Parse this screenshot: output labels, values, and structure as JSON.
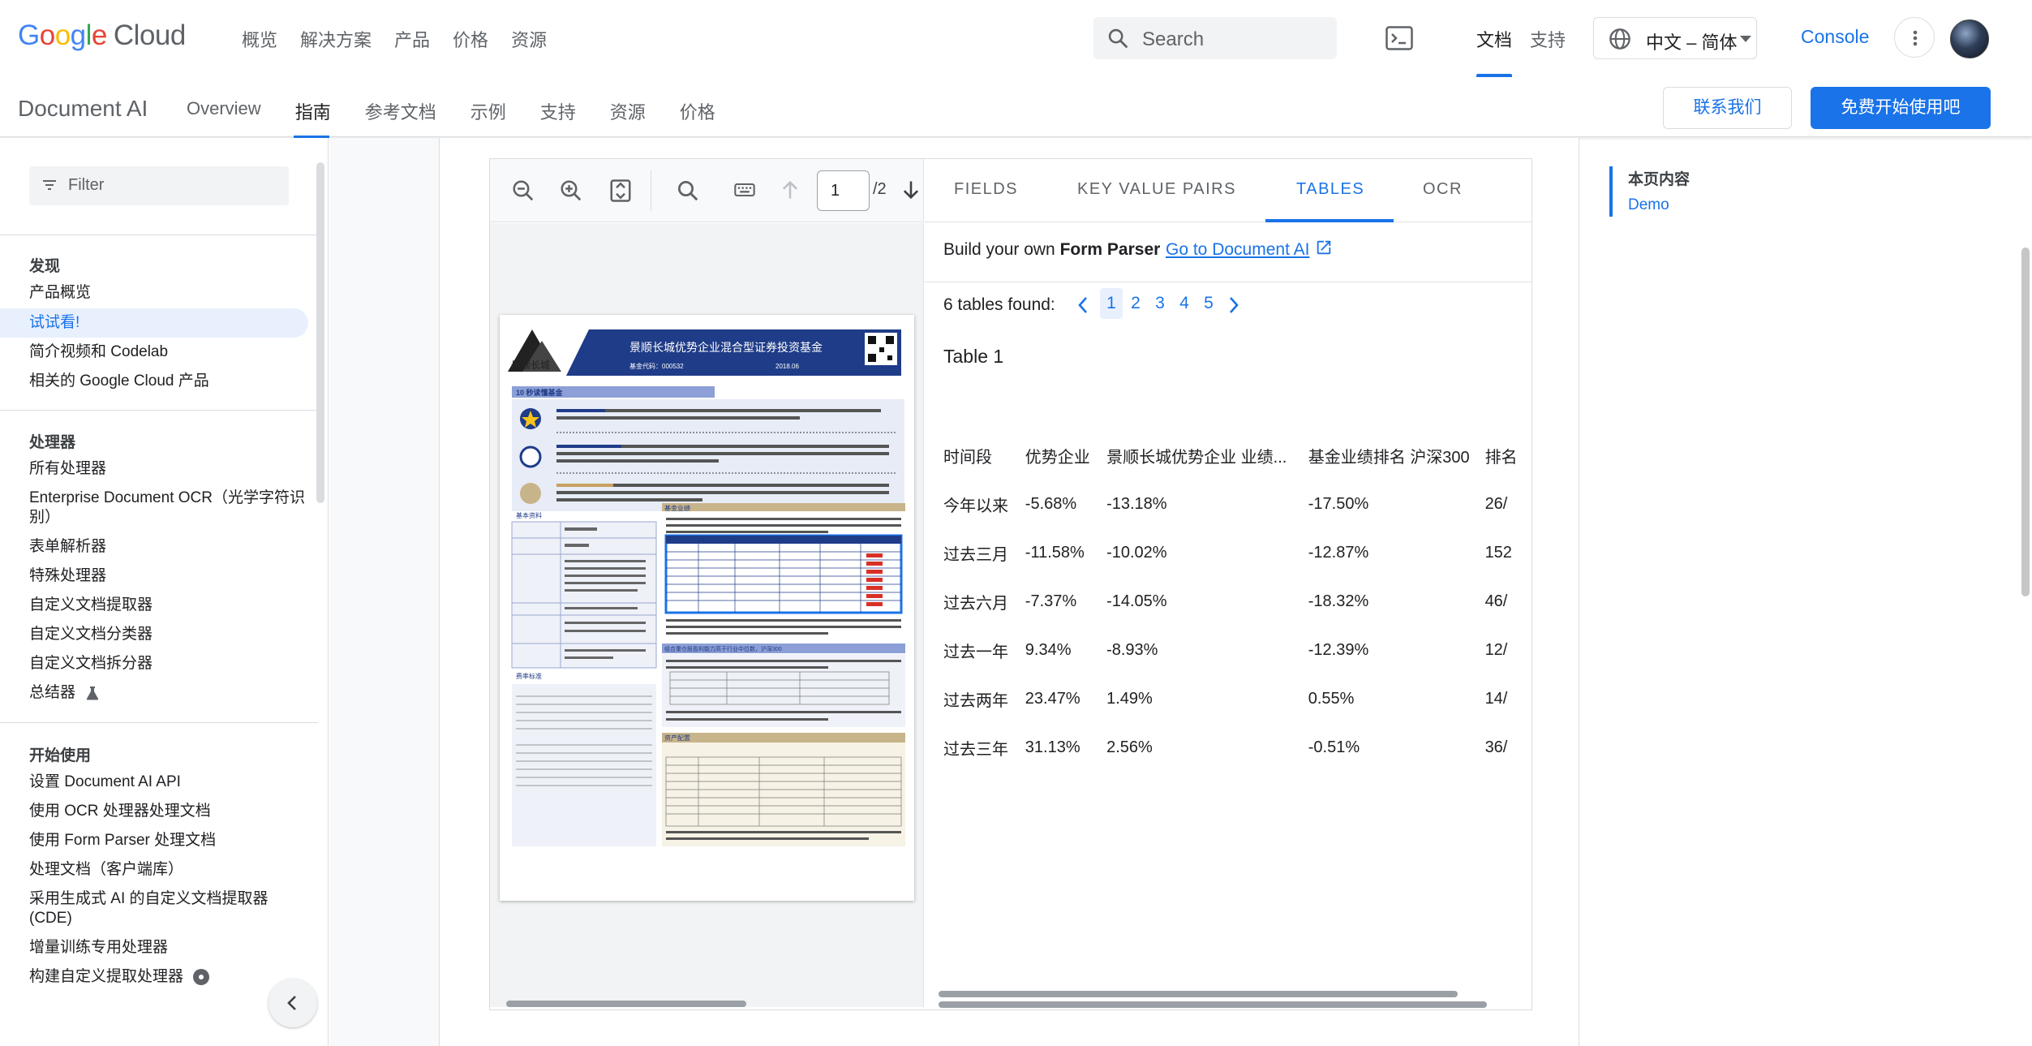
{
  "topbar": {
    "logo_google": "Google",
    "logo_cloud": "Cloud",
    "nav": [
      "概览",
      "解决方案",
      "产品",
      "价格",
      "资源"
    ],
    "search_placeholder": "Search",
    "docs": "文档",
    "support": "支持",
    "language": "中文 – 简体",
    "console": "Console"
  },
  "productbar": {
    "name": "Document AI",
    "nav": [
      "Overview",
      "指南",
      "参考文档",
      "示例",
      "支持",
      "资源",
      "价格"
    ],
    "active": "指南",
    "contact": "联系我们",
    "free": "免费开始使用吧"
  },
  "sidebar": {
    "filter_placeholder": "Filter",
    "sections": [
      {
        "heading": "发现",
        "items": [
          "产品概览",
          "试试看!",
          "简介视频和 Codelab",
          "相关的 Google Cloud 产品"
        ]
      },
      {
        "heading": "处理器",
        "items": [
          "所有处理器",
          "Enterprise Document OCR（光学字符识别）",
          "表单解析器",
          "特殊处理器",
          "自定义文档提取器",
          "自定义文档分类器",
          "自定义文档拆分器",
          "总结器"
        ]
      },
      {
        "heading": "开始使用",
        "items": [
          "设置 Document AI API",
          "使用 OCR 处理器处理文档",
          "使用 Form Parser 处理文档",
          "处理文档（客户端库）",
          "采用生成式 AI 的自定义文档提取器 (CDE)",
          "增量训练专用处理器",
          "构建自定义提取处理器"
        ]
      }
    ],
    "active_item": "试试看!"
  },
  "viewer": {
    "page_current": "1",
    "page_total": "/2"
  },
  "tabs": [
    "FIELDS",
    "KEY VALUE PAIRS",
    "TABLES",
    "OCR"
  ],
  "active_tab": "TABLES",
  "form_parser": {
    "prefix": "Build your own ",
    "bold": "Form Parser",
    "link": "Go to Document AI"
  },
  "tables": {
    "found_label": "6 tables found:",
    "pages": [
      "1",
      "2",
      "3",
      "4",
      "5"
    ],
    "current_page": "1",
    "title": "Table 1",
    "headers": [
      "时间段",
      "优势企业",
      "景顺长城优势企业 业绩...",
      "基金业绩排名 沪深300",
      "排名"
    ],
    "rows": [
      [
        "今年以来",
        "-5.68%",
        "-13.18%",
        "-17.50%",
        "26/"
      ],
      [
        "过去三月",
        "-11.58%",
        "-10.02%",
        "-12.87%",
        "152"
      ],
      [
        "过去六月",
        "-7.37%",
        "-14.05%",
        "-18.32%",
        "46/"
      ],
      [
        "过去一年",
        "9.34%",
        "-8.93%",
        "-12.39%",
        "12/"
      ],
      [
        "过去两年",
        "23.47%",
        "1.49%",
        "0.55%",
        "14/"
      ],
      [
        "过去三年",
        "31.13%",
        "2.56%",
        "-0.51%",
        "36/"
      ]
    ]
  },
  "toc": {
    "heading": "本页内容",
    "items": [
      "Demo"
    ]
  },
  "document_thumbnail": {
    "title": "景顺长城优势企业混合型证券投资基金",
    "fund_code": "基金代码：000532",
    "date": "2018.06",
    "company": "景顺长城",
    "sections": [
      "10 秒读懂基金",
      "基本资料",
      "基金业绩",
      "组合重仓股盈利能力高于行业中位数，沪深300",
      "费率标准",
      "资产配置"
    ]
  },
  "colors": {
    "accent": "#1a73e8",
    "doc_navy": "#1f3c88",
    "doc_red": "#d93025"
  }
}
